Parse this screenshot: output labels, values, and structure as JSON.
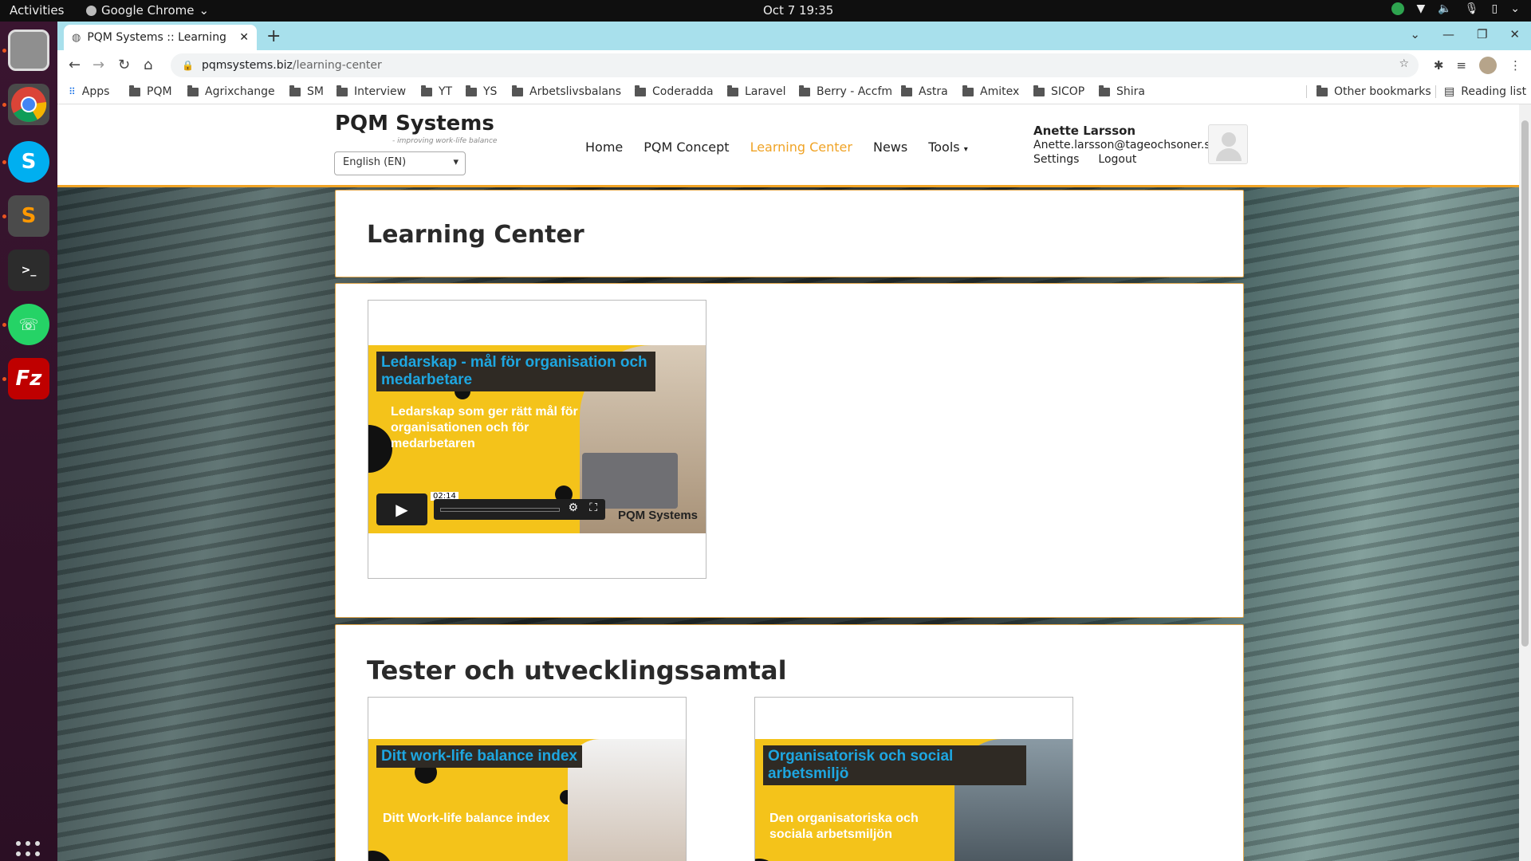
{
  "os": {
    "activities": "Activities",
    "app_name": "Google Chrome",
    "clock": "Oct 7  19:35"
  },
  "chrome": {
    "tab_title": "PQM Systems :: Learning",
    "url_host": "pqmsystems.biz",
    "url_path": "/learning-center",
    "bookmarks": [
      "Apps",
      "PQM",
      "Agrixchange",
      "SM",
      "Interview",
      "YT",
      "YS",
      "Arbetslivsbalans",
      "Coderadda",
      "Laravel",
      "Berry - Accfm",
      "Astra",
      "Amitex",
      "SICOP",
      "Shira"
    ],
    "other_bookmarks": "Other bookmarks",
    "reading_list": "Reading list"
  },
  "site": {
    "logo": "PQM Systems",
    "tagline": "- improving work-life balance",
    "language": "English (EN)",
    "nav": [
      "Home",
      "PQM Concept",
      "Learning Center",
      "News",
      "Tools"
    ],
    "active_nav": "Learning Center",
    "user": {
      "name": "Anette Larsson",
      "email": "Anette.larsson@tageochsoner.se",
      "settings": "Settings",
      "logout": "Logout"
    }
  },
  "content": {
    "page_title": "Learning Center",
    "video1": {
      "title": "Ledarskap - mål för organisation och medarbetare",
      "subtitle": "Ledarskap som ger rätt mål för organisationen och för medarbetaren",
      "duration": "02:14",
      "brand": "PQM Systems"
    },
    "section2_title": "Tester och utvecklingssamtal",
    "video2": {
      "title": "Ditt work-life balance index",
      "subtitle": "Ditt Work-life balance index"
    },
    "video3": {
      "title": "Organisatorisk och social arbetsmiljö",
      "subtitle": "Den organisatoriska och sociala arbetsmiljön"
    }
  },
  "colors": {
    "accent": "#f0a325",
    "thumb_yellow": "#f4c31a",
    "video_title": "#1ea6e0"
  }
}
